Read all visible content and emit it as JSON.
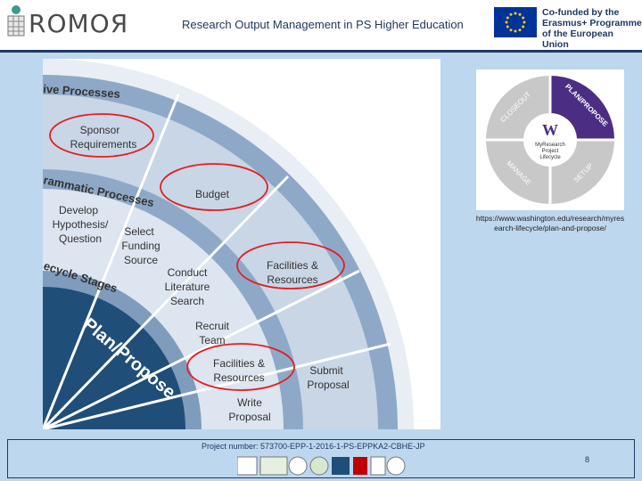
{
  "header": {
    "logo_text": "ROMOЯ",
    "title": "Research Output Management in PS Higher Education",
    "eu_line1": "Co-funded by the",
    "eu_line2": "Erasmus+ Programme",
    "eu_line3": "of the European Union"
  },
  "figure": {
    "band_labels": [
      "ive Processes",
      "rammatic Processes",
      "ecycle Stages"
    ],
    "center_label": "Plan/Propose",
    "outer_items": [
      "Sponsor",
      "Requirements",
      "Budget",
      "Facilities &",
      "Resources"
    ],
    "middle_items": [
      "Develop",
      "Hypothesis/",
      "Question",
      "Select",
      "Funding",
      "Source",
      "Conduct",
      "Literature",
      "Search",
      "Recruit",
      "Team",
      "Facilities &",
      "Resources",
      "Submit",
      "Proposal",
      "Write",
      "Proposal"
    ]
  },
  "side_figure": {
    "center_letter": "W",
    "center_line1": "MyResearch",
    "center_line2": "Project",
    "center_line3": "Lifecycle",
    "segment_plan": "PLAN/PROPOSE",
    "segment_setup": "SETUP",
    "segment_manage": "MANAGE",
    "segment_closeout": "CLOSEOUT"
  },
  "caption": {
    "line1": "https://www.washington.edu/research/myres",
    "line2": "earch-lifecycle/plan-and-propose/"
  },
  "footer": {
    "project": "Project number: 573700-EPP-1-2016-1-PS-EPPKA2-CBHE-JP",
    "page": "8"
  },
  "colors": {
    "accent_dark": "#1f3864",
    "ring_dark": "#1f4e79",
    "ring_mid": "#b7c9df",
    "circle_red": "#e02020"
  }
}
